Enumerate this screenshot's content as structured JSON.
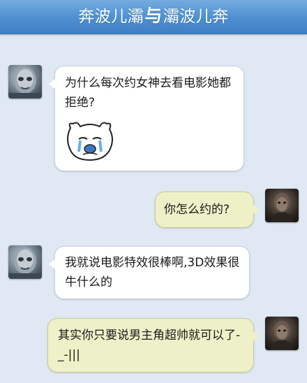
{
  "header": {
    "title_left": "奔波儿灞",
    "title_sep": "与",
    "title_right": "灞波儿奔"
  },
  "messages": [
    {
      "side": "left",
      "avatar": "alien-face-avatar",
      "text": "为什么每次约女神去看电影她都拒绝?",
      "sticker": "crying-bear-sticker"
    },
    {
      "side": "right",
      "avatar": "dark-figure-avatar",
      "text": "你怎么约的?"
    },
    {
      "side": "left",
      "avatar": "alien-face-avatar",
      "text": "我就说电影特效很棒啊,3D效果很牛什么的"
    },
    {
      "side": "right",
      "avatar": "dark-figure-avatar",
      "text": "其实你只要说男主角超帅就可以了-_-|||"
    }
  ],
  "colors": {
    "background": "#dfe8f3",
    "header": "#4d8fd0",
    "bubble_left": "#ffffff",
    "bubble_right": "#eef0c7"
  }
}
